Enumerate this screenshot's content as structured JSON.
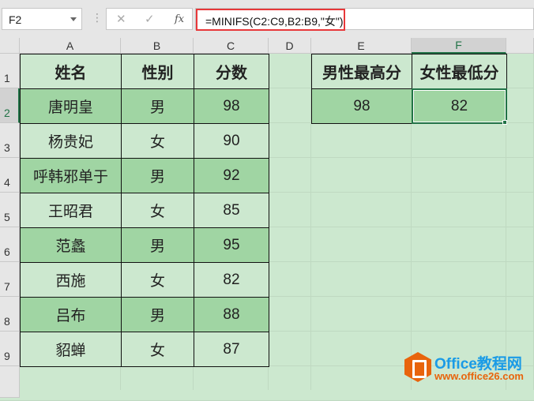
{
  "name_box": "F2",
  "formula": "=MINIFS(C2:C9,B2:B9,\"女\")",
  "icons": {
    "cancel": "✕",
    "enter": "✓",
    "fx": "fx"
  },
  "columns": [
    "A",
    "B",
    "C",
    "D",
    "E",
    "F"
  ],
  "rows": [
    "1",
    "2",
    "3",
    "4",
    "5",
    "6",
    "7",
    "8",
    "9"
  ],
  "table": {
    "headers": [
      "姓名",
      "性别",
      "分数"
    ],
    "rows": [
      [
        "唐明皇",
        "男",
        "98"
      ],
      [
        "杨贵妃",
        "女",
        "90"
      ],
      [
        "呼韩邪单于",
        "男",
        "92"
      ],
      [
        "王昭君",
        "女",
        "85"
      ],
      [
        "范蠡",
        "男",
        "95"
      ],
      [
        "西施",
        "女",
        "82"
      ],
      [
        "吕布",
        "男",
        "88"
      ],
      [
        "貂蝉",
        "女",
        "87"
      ]
    ]
  },
  "summary": {
    "headers": [
      "男性最高分",
      "女性最低分"
    ],
    "values": [
      "98",
      "82"
    ]
  },
  "selected_cell": "F2",
  "logo": {
    "title": "Office教程网",
    "url": "www.office26.com"
  }
}
